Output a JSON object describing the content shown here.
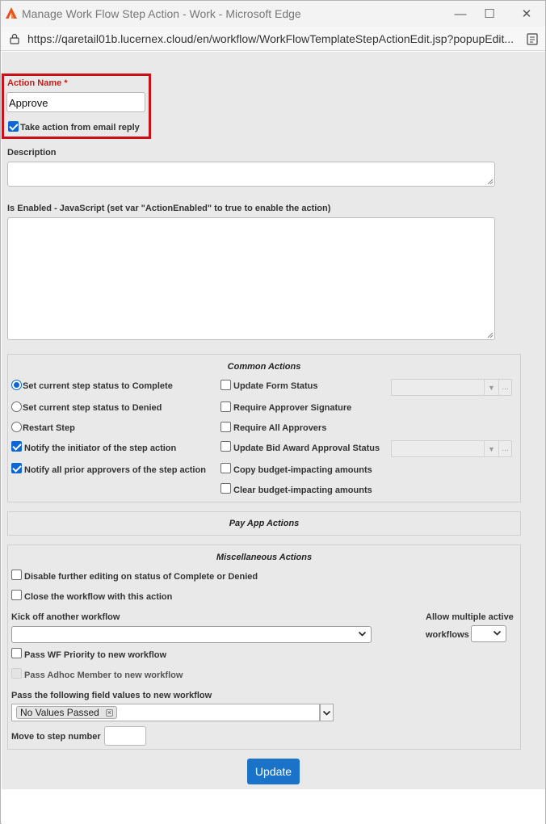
{
  "window": {
    "title": "Manage Work Flow Step Action - Work - Microsoft Edge",
    "url": "https://qaretail01b.lucernex.cloud/en/workflow/WorkFlowTemplateStepActionEdit.jsp?popupEdit...",
    "controls": {
      "minimize": "—",
      "maximize": "☐",
      "close": "✕"
    }
  },
  "form": {
    "action_name_label": "Action Name",
    "required_mark": "*",
    "action_name_value": "Approve",
    "email_reply_label": "Take action from email reply",
    "email_reply_checked": true,
    "description_label": "Description",
    "description_value": "",
    "is_enabled_label": "Is Enabled - JavaScript (set var \"ActionEnabled\" to true to enable the action)",
    "is_enabled_value": ""
  },
  "common_actions": {
    "title": "Common Actions",
    "left": [
      {
        "label": "Set current step status to Complete",
        "type": "radio",
        "checked": true
      },
      {
        "label": "Set current step status to Denied",
        "type": "radio",
        "checked": false
      },
      {
        "label": "Restart Step",
        "type": "radio",
        "checked": false
      },
      {
        "label": "Notify the initiator of the step action",
        "type": "checkbox",
        "checked": true
      },
      {
        "label": "Notify all prior approvers of the step action",
        "type": "checkbox",
        "checked": true
      }
    ],
    "right": [
      {
        "label": "Update Form Status",
        "checked": false
      },
      {
        "label": "Require Approver Signature",
        "checked": false
      },
      {
        "label": "Require All Approvers",
        "checked": false
      },
      {
        "label": "Update Bid Award Approval Status",
        "checked": false
      },
      {
        "label": "Copy budget-impacting amounts",
        "checked": false
      },
      {
        "label": "Clear budget-impacting amounts",
        "checked": false
      }
    ],
    "more_glyph": "..."
  },
  "pay_app": {
    "title": "Pay App Actions"
  },
  "misc": {
    "title": "Miscellaneous Actions",
    "disable_editing_label": "Disable further editing on status of Complete or Denied",
    "close_workflow_label": "Close the workflow with this action",
    "kickoff_label": "Kick off another workflow",
    "kickoff_value": "",
    "allow_multiple_label_1": "Allow multiple active",
    "allow_multiple_label_2": "workflows",
    "allow_multiple_value": "",
    "pass_priority_label": "Pass WF Priority to new workflow",
    "pass_adhoc_label": "Pass Adhoc Member to new workflow",
    "pass_fields_label": "Pass the following field values to new workflow",
    "pass_fields_tag": "No Values Passed",
    "tag_remove": "×",
    "move_step_label": "Move to step number",
    "move_step_value": ""
  },
  "update_button": "Update",
  "colors": {
    "highlight": "#cc0f19",
    "accent": "#0b66d6",
    "button": "#1a73c8",
    "required": "#c0201a"
  }
}
